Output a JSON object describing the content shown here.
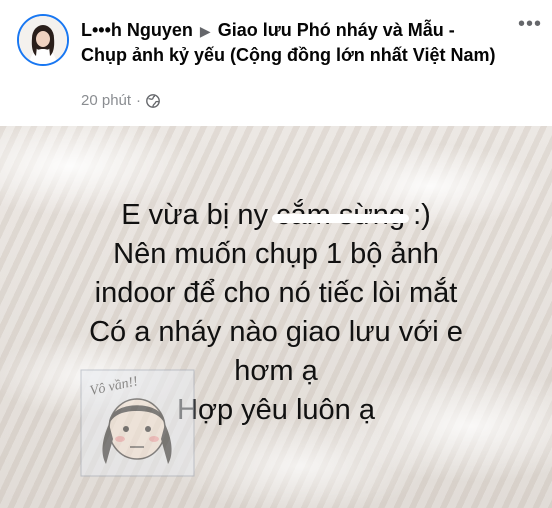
{
  "post": {
    "author_name": "L•••h Nguyen",
    "arrow": "▶",
    "group_name": "Giao lưu Phó nháy và Mẫu - Chụp ảnh kỷ yếu (Cộng đồng lớn nhất Việt Nam)",
    "time": "20 phút",
    "separator": "·",
    "privacy_icon": "globe-icon",
    "more_label": "•••"
  },
  "image": {
    "lines": {
      "line1_before": "E vừa bị ny ",
      "line1_struck": "cắm sừng",
      "line1_after": " :)",
      "line2": "Nên muốn chụp 1 bộ ảnh",
      "line3": "indoor để cho nó tiếc lòi mắt",
      "line4": "Có a nháy nào giao lưu với e",
      "line5": "hơm ạ",
      "line6": "Hợp yêu luôn ạ"
    },
    "sticker_text": "Vô vần!!"
  },
  "colors": {
    "accent": "#1877f2",
    "meta_text": "#8a8d91",
    "redaction": "#f7c8d3"
  }
}
